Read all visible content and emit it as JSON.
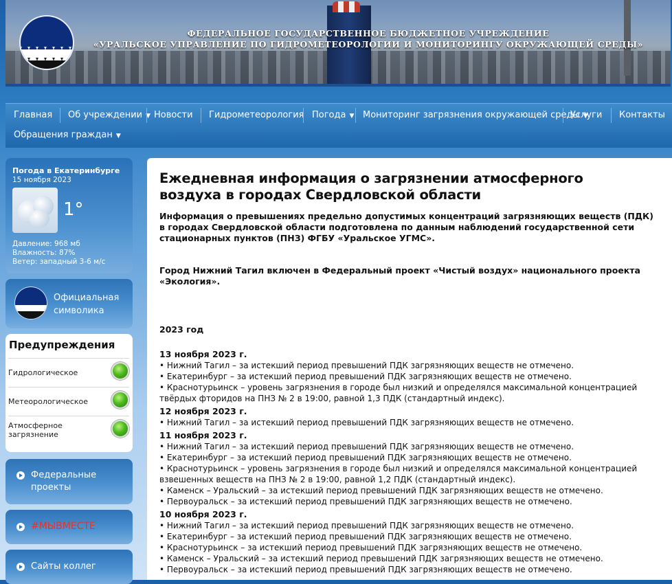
{
  "header": {
    "title_line1": "ФЕДЕРАЛЬНОЕ ГОСУДАРСТВЕННОЕ БЮДЖЕТНОЕ УЧРЕЖДЕНИЕ",
    "title_line2": "«УРАЛЬСКОЕ УПРАВЛЕНИЕ ПО ГИДРОМЕТЕОРОЛОГИИ И МОНИТОРИНГУ ОКРУЖАЮЩЕЙ СРЕДЫ»",
    "logo_icon": "ugms-logo-icon"
  },
  "nav": {
    "items": [
      {
        "label": "Главная"
      },
      {
        "label": "Об учреждении",
        "dropdown": true
      },
      {
        "label": "Новости"
      },
      {
        "label": "Гидрометеорология"
      },
      {
        "label": "Погода",
        "dropdown": true
      },
      {
        "label": "Мониторинг загрязнения окружающей среды",
        "dropdown": true
      },
      {
        "label": "Услуги"
      },
      {
        "label": "Контакты"
      },
      {
        "label": "Обращения граждан",
        "dropdown": true
      }
    ],
    "caret": "▼"
  },
  "weather": {
    "title": "Погода в Екатеринбурге",
    "date": "15 ноября 2023",
    "temperature": "1°",
    "pressure": "Давление: 968 мб",
    "humidity": "Влажность: 87%",
    "wind": "Ветер: западный 3-6 м/с",
    "icon": "cloud-icon"
  },
  "sidebar": {
    "symbolics": "Официальная символика",
    "warnings_title": "Предупреждения",
    "warnings": [
      {
        "label": "Гидрологическое",
        "status": "green"
      },
      {
        "label": "Метеорологическое",
        "status": "green"
      },
      {
        "label": "Атмосферное загрязнение",
        "status": "green"
      }
    ],
    "links": [
      {
        "label": "Федеральные проекты",
        "color": "#ffffff"
      },
      {
        "label": "#МЫВМЕСТЕ",
        "color": "#e8322b"
      },
      {
        "label": "Сайты коллег",
        "color": "#ffffff"
      }
    ]
  },
  "main": {
    "title": "Ежедневная информация о загрязнении атмосферного воздуха в городах Свердловской области",
    "intro": "Информация о превышениях предельно допустимых концентраций загрязняющих веществ (ПДК) в городах Свердловской области подготовлена по данным наблюдений государственной сети стационарных пунктов (ПНЗ) ФГБУ «Уральское УГМС».",
    "project_note": "Город Нижний Тагил включен в Федеральный проект «Чистый воздух» национального проекта «Экология».",
    "year": "2023 год",
    "days": [
      {
        "date": "13 ноября 2023 г.",
        "items": [
          "• Нижний Тагил – за истекший период превышений ПДК загрязняющих веществ не отмечено.",
          "• Екатеринбург – за истекший период превышений ПДК загрязняющих веществ не отмечено.",
          "• Краснотурьинск – уровень загрязнения в городе был низкий и определялся максимальной концентрацией твёрдых фторидов на ПНЗ № 2 в 19:00, равной 1,3 ПДК (стандартный индекс)."
        ]
      },
      {
        "date": "12 ноября 2023 г.",
        "items": [
          "• Нижний Тагил – за истекший период превышений ПДК загрязняющих веществ не отмечено."
        ]
      },
      {
        "date": "11 ноября 2023 г.",
        "items": [
          "• Нижний Тагил – за истекший период превышений ПДК загрязняющих веществ не отмечено.",
          "• Екатеринбург – за истекший период превышений ПДК загрязняющих веществ не отмечено.",
          "• Краснотурьинск – уровень загрязнения в городе был низкий и определялся максимальной концентрацией взвешенных веществ на ПНЗ № 2 в 19:00, равной 1,2 ПДК (стандартный индекс).",
          "• Каменск – Уральский – за истекший период превышений ПДК загрязняющих веществ не отмечено.",
          "• Первоуральск – за истекший период превышений ПДК загрязняющих веществ не отмечено."
        ]
      },
      {
        "date": "10 ноября 2023 г.",
        "items": [
          "• Нижний Тагил – за истекший период превышений ПДК загрязняющих веществ не отмечено.",
          "• Екатеринбург – за истекший период превышений ПДК загрязняющих веществ не отмечено.",
          "• Краснотурьинск – за истекший период превышений ПДК загрязняющих веществ не отмечено.",
          "• Каменск – Уральский – за истекший период превышений ПДК загрязняющих веществ не отмечено.",
          "• Первоуральск – за истекший период превышений ПДК загрязняющих веществ не отмечено."
        ]
      }
    ]
  }
}
